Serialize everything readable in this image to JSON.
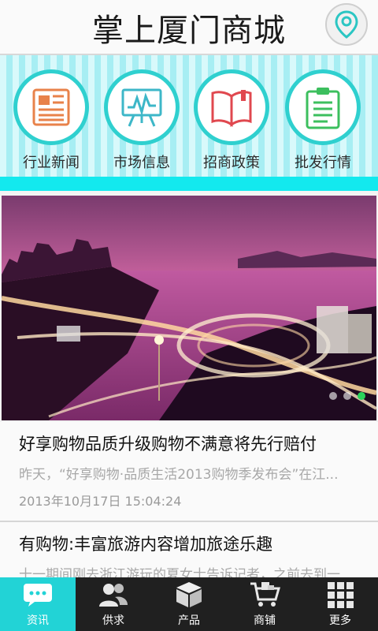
{
  "header": {
    "title": "掌上厦门商城"
  },
  "categories": [
    {
      "label": "行业新闻",
      "icon": "newspaper-icon"
    },
    {
      "label": "市场信息",
      "icon": "chart-board-icon"
    },
    {
      "label": "招商政策",
      "icon": "open-book-icon"
    },
    {
      "label": "批发行情",
      "icon": "clipboard-icon"
    }
  ],
  "banner": {
    "slide_count": 3,
    "active_slide": 3
  },
  "news": [
    {
      "title": "好享购物品质升级购物不满意将先行赔付",
      "summary": "昨天，“好享购物·品质生活2013购物季发布会”在江...",
      "time": "2013年10月17日 15:04:24"
    },
    {
      "title": "有购物:丰富旅游内容增加旅途乐趣",
      "summary": "十一期间刚去浙江游玩的夏女士告诉记者，之前去到一"
    }
  ],
  "nav": [
    {
      "label": "资讯",
      "icon": "chat-bubble-icon",
      "active": true
    },
    {
      "label": "供求",
      "icon": "users-icon"
    },
    {
      "label": "产品",
      "icon": "box-icon"
    },
    {
      "label": "商铺",
      "icon": "cart-icon"
    },
    {
      "label": "更多",
      "icon": "grid-icon"
    }
  ],
  "colors": {
    "accent": "#22d3d6",
    "nav_bg": "#202020",
    "ring": "#2fd0cf"
  }
}
